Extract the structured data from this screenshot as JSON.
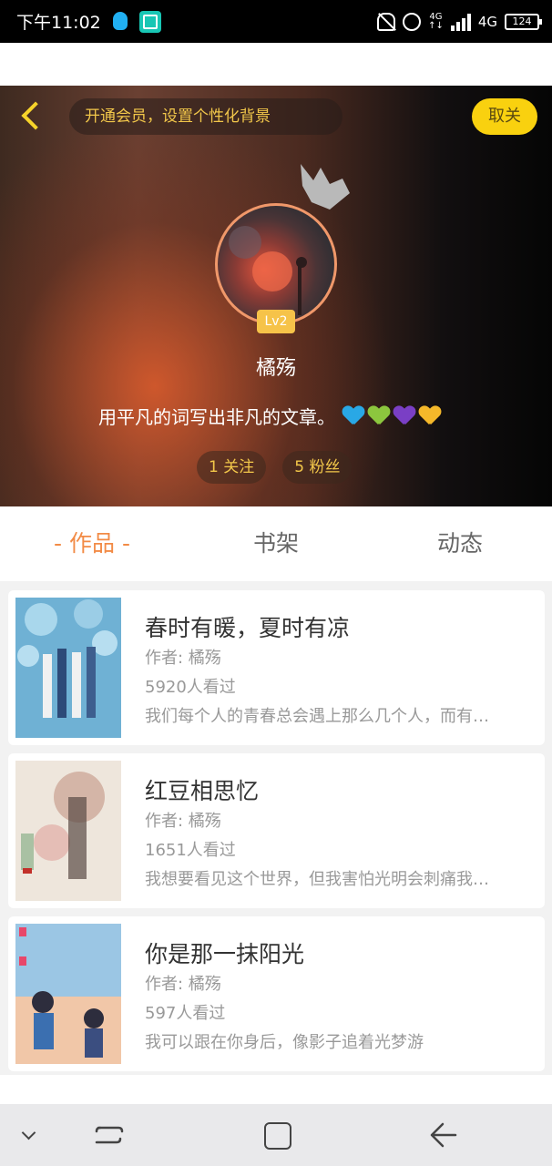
{
  "status_bar": {
    "time": "下午11:02",
    "network_small_top": "4G",
    "network_small_bottom": "↑↓",
    "network": "4G",
    "battery": "124"
  },
  "header": {
    "vip_banner": "开通会员，设置个性化背景",
    "unfollow_label": "取关",
    "level": "Lv2",
    "username": "橘殇",
    "bio": "用平凡的词写出非凡的文章。",
    "hearts": [
      "#29a8e6",
      "#8cc63e",
      "#7a3fc5",
      "#f5b82a"
    ],
    "following": "1 关注",
    "followers": "5 粉丝"
  },
  "tabs": {
    "works": "- 作品 -",
    "bookshelf": "书架",
    "activity": "动态"
  },
  "books": [
    {
      "title": "春时有暖，夏时有凉",
      "author": "作者: 橘殇",
      "views": "5920人看过",
      "desc": "我们每个人的青春总会遇上那么几个人，而有…"
    },
    {
      "title": "红豆相思忆",
      "author": "作者: 橘殇",
      "views": "1651人看过",
      "desc": "我想要看见这个世界，但我害怕光明会刺痛我…"
    },
    {
      "title": "你是那一抹阳光",
      "author": "作者: 橘殇",
      "views": "597人看过",
      "desc": "我可以跟在你身后，像影子追着光梦游"
    }
  ],
  "colors": {
    "accent_orange": "#f28b46",
    "vip_yellow": "#f9d10f"
  }
}
